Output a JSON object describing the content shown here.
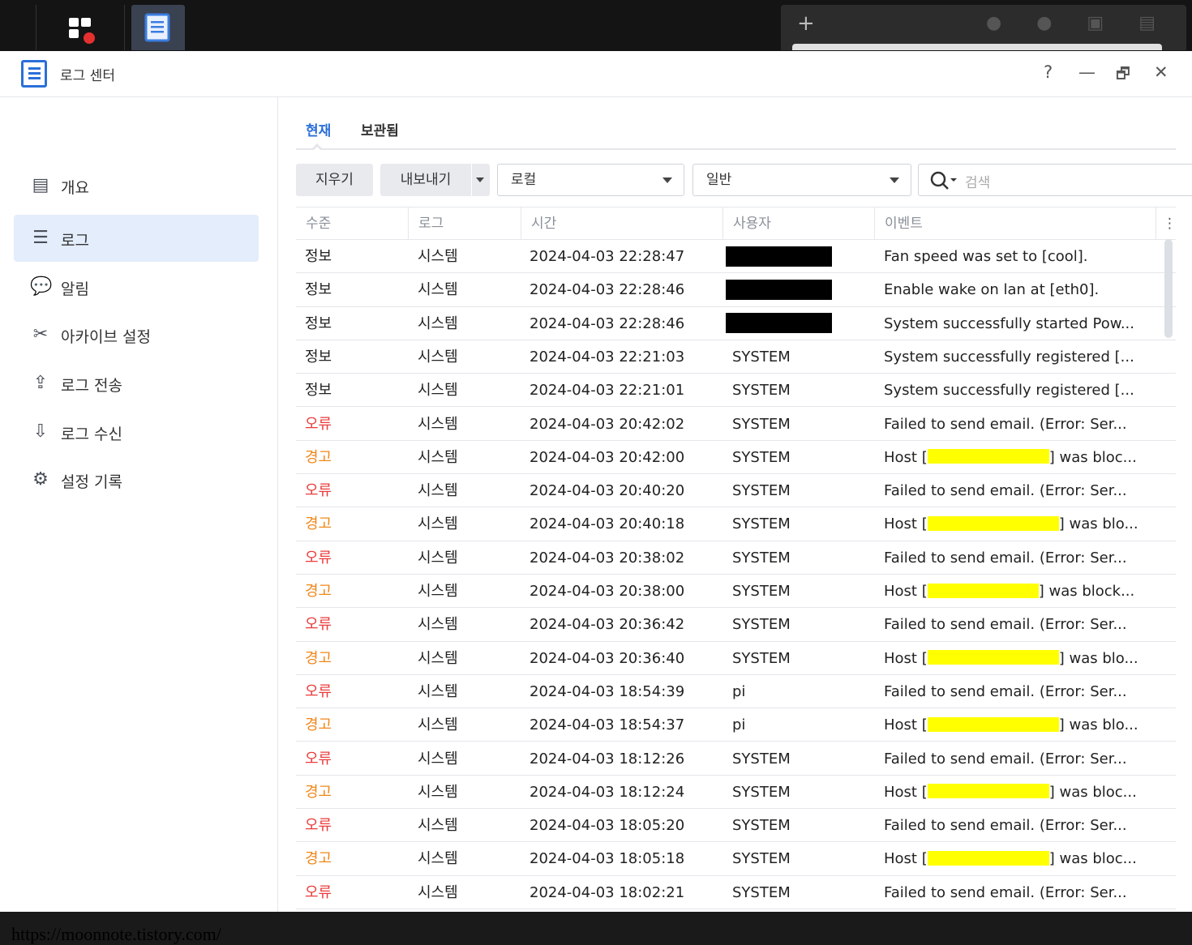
{
  "app": {
    "title": "로그 센터"
  },
  "window_controls": {
    "help": "?",
    "minimize": "—",
    "restore": "🗗",
    "close": "✕"
  },
  "taskbar": {
    "add": "+"
  },
  "sidebar": {
    "items": [
      {
        "label": "개요",
        "icon": "overview-icon",
        "glyph": "▤"
      },
      {
        "label": "로그",
        "icon": "list-icon",
        "glyph": "☰"
      },
      {
        "label": "알림",
        "icon": "chat-icon",
        "glyph": "💬"
      },
      {
        "label": "아카이브 설정",
        "icon": "tools-icon",
        "glyph": "✂"
      },
      {
        "label": "로그 전송",
        "icon": "send-icon",
        "glyph": "⇪"
      },
      {
        "label": "로그 수신",
        "icon": "receive-icon",
        "glyph": "⇩"
      },
      {
        "label": "설정 기록",
        "icon": "gear-icon",
        "glyph": "⚙"
      }
    ]
  },
  "watermark": "https://moonnote.tistory.com/",
  "tabs": {
    "current": "현재",
    "archived": "보관됨"
  },
  "toolbar": {
    "clear": "지우기",
    "export": "내보내기",
    "source": "로컬",
    "category": "일반",
    "search_placeholder": "검색"
  },
  "columns": [
    "수준",
    "로그",
    "시간",
    "사용자",
    "이벤트"
  ],
  "rows": [
    {
      "level": "정보",
      "type": "info",
      "log": "시스템",
      "time": "2024-04-03 22:28:47",
      "user": "",
      "user_redacted": true,
      "event": "Fan speed was set to [cool].",
      "event_suffix": ""
    },
    {
      "level": "정보",
      "type": "info",
      "log": "시스템",
      "time": "2024-04-03 22:28:46",
      "user": "",
      "user_redacted": true,
      "event": "Enable wake on lan at [eth0].",
      "event_suffix": ""
    },
    {
      "level": "정보",
      "type": "info",
      "log": "시스템",
      "time": "2024-04-03 22:28:46",
      "user": "",
      "user_redacted": true,
      "event": "System successfully started Pow...",
      "event_suffix": ""
    },
    {
      "level": "정보",
      "type": "info",
      "log": "시스템",
      "time": "2024-04-03 22:21:03",
      "user": "SYSTEM",
      "event": "System successfully registered [...",
      "event_suffix": ""
    },
    {
      "level": "정보",
      "type": "info",
      "log": "시스템",
      "time": "2024-04-03 22:21:01",
      "user": "SYSTEM",
      "event": "System successfully registered [...",
      "event_suffix": ""
    },
    {
      "level": "오류",
      "type": "err",
      "log": "시스템",
      "time": "2024-04-03 20:42:02",
      "user": "SYSTEM",
      "event": "Failed to send email. (Error: Ser...",
      "event_suffix": ""
    },
    {
      "level": "경고",
      "type": "warn",
      "log": "시스템",
      "time": "2024-04-03 20:42:00",
      "user": "SYSTEM",
      "event": "Host [",
      "redact": true,
      "event_suffix": "] was bloc..."
    },
    {
      "level": "오류",
      "type": "err",
      "log": "시스템",
      "time": "2024-04-03 20:40:20",
      "user": "SYSTEM",
      "event": "Failed to send email. (Error: Ser...",
      "event_suffix": ""
    },
    {
      "level": "경고",
      "type": "warn",
      "log": "시스템",
      "time": "2024-04-03 20:40:18",
      "user": "SYSTEM",
      "event": "Host [",
      "redact": true,
      "event_suffix": "] was blo..."
    },
    {
      "level": "오류",
      "type": "err",
      "log": "시스템",
      "time": "2024-04-03 20:38:02",
      "user": "SYSTEM",
      "event": "Failed to send email. (Error: Ser...",
      "event_suffix": ""
    },
    {
      "level": "경고",
      "type": "warn",
      "log": "시스템",
      "time": "2024-04-03 20:38:00",
      "user": "SYSTEM",
      "event": "Host [",
      "redact": true,
      "event_suffix": "] was block..."
    },
    {
      "level": "오류",
      "type": "err",
      "log": "시스템",
      "time": "2024-04-03 20:36:42",
      "user": "SYSTEM",
      "event": "Failed to send email. (Error: Ser...",
      "event_suffix": ""
    },
    {
      "level": "경고",
      "type": "warn",
      "log": "시스템",
      "time": "2024-04-03 20:36:40",
      "user": "SYSTEM",
      "event": "Host [",
      "redact": true,
      "event_suffix": "] was blo..."
    },
    {
      "level": "오류",
      "type": "err",
      "log": "시스템",
      "time": "2024-04-03 18:54:39",
      "user": "pi",
      "event": "Failed to send email. (Error: Ser...",
      "event_suffix": ""
    },
    {
      "level": "경고",
      "type": "warn",
      "log": "시스템",
      "time": "2024-04-03 18:54:37",
      "user": "pi",
      "event": "Host [",
      "redact": true,
      "event_suffix": "] was blo..."
    },
    {
      "level": "오류",
      "type": "err",
      "log": "시스템",
      "time": "2024-04-03 18:12:26",
      "user": "SYSTEM",
      "event": "Failed to send email. (Error: Ser...",
      "event_suffix": ""
    },
    {
      "level": "경고",
      "type": "warn",
      "log": "시스템",
      "time": "2024-04-03 18:12:24",
      "user": "SYSTEM",
      "event": "Host [",
      "redact": true,
      "event_suffix": "] was bloc..."
    },
    {
      "level": "오류",
      "type": "err",
      "log": "시스템",
      "time": "2024-04-03 18:05:20",
      "user": "SYSTEM",
      "event": "Failed to send email. (Error: Ser...",
      "event_suffix": ""
    },
    {
      "level": "경고",
      "type": "warn",
      "log": "시스템",
      "time": "2024-04-03 18:05:18",
      "user": "SYSTEM",
      "event": "Host [",
      "redact": true,
      "event_suffix": "] was bloc..."
    },
    {
      "level": "오류",
      "type": "err",
      "log": "시스템",
      "time": "2024-04-03 18:02:21",
      "user": "SYSTEM",
      "event": "Failed to send email. (Error: Ser...",
      "event_suffix": ""
    }
  ],
  "colors": {
    "accent": "#2b6fd8",
    "error": "#ea3b3b",
    "warning": "#f0871a",
    "redact_black": "#000000",
    "redact_yellow": "#ffff00"
  }
}
